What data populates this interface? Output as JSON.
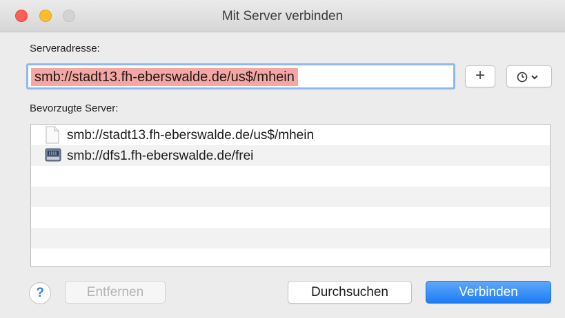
{
  "window": {
    "title": "Mit Server verbinden"
  },
  "server_address": {
    "label": "Serveradresse:",
    "value": "smb://stadt13.fh-eberswalde.de/us$/mhein"
  },
  "add_button_label": "+",
  "favorites": {
    "label": "Bevorzugte Server:",
    "items": [
      {
        "address": "smb://stadt13.fh-eberswalde.de/us$/mhein",
        "icon": "document-icon"
      },
      {
        "address": "smb://dfs1.fh-eberswalde.de/frei",
        "icon": "network-server-icon"
      }
    ]
  },
  "buttons": {
    "help": "?",
    "remove": "Entfernen",
    "browse": "Durchsuchen",
    "connect": "Verbinden"
  },
  "colors": {
    "selection_highlight": "#f6a7a4",
    "focus_ring": "#8fb8ec",
    "primary_button": "#1c7df3"
  }
}
